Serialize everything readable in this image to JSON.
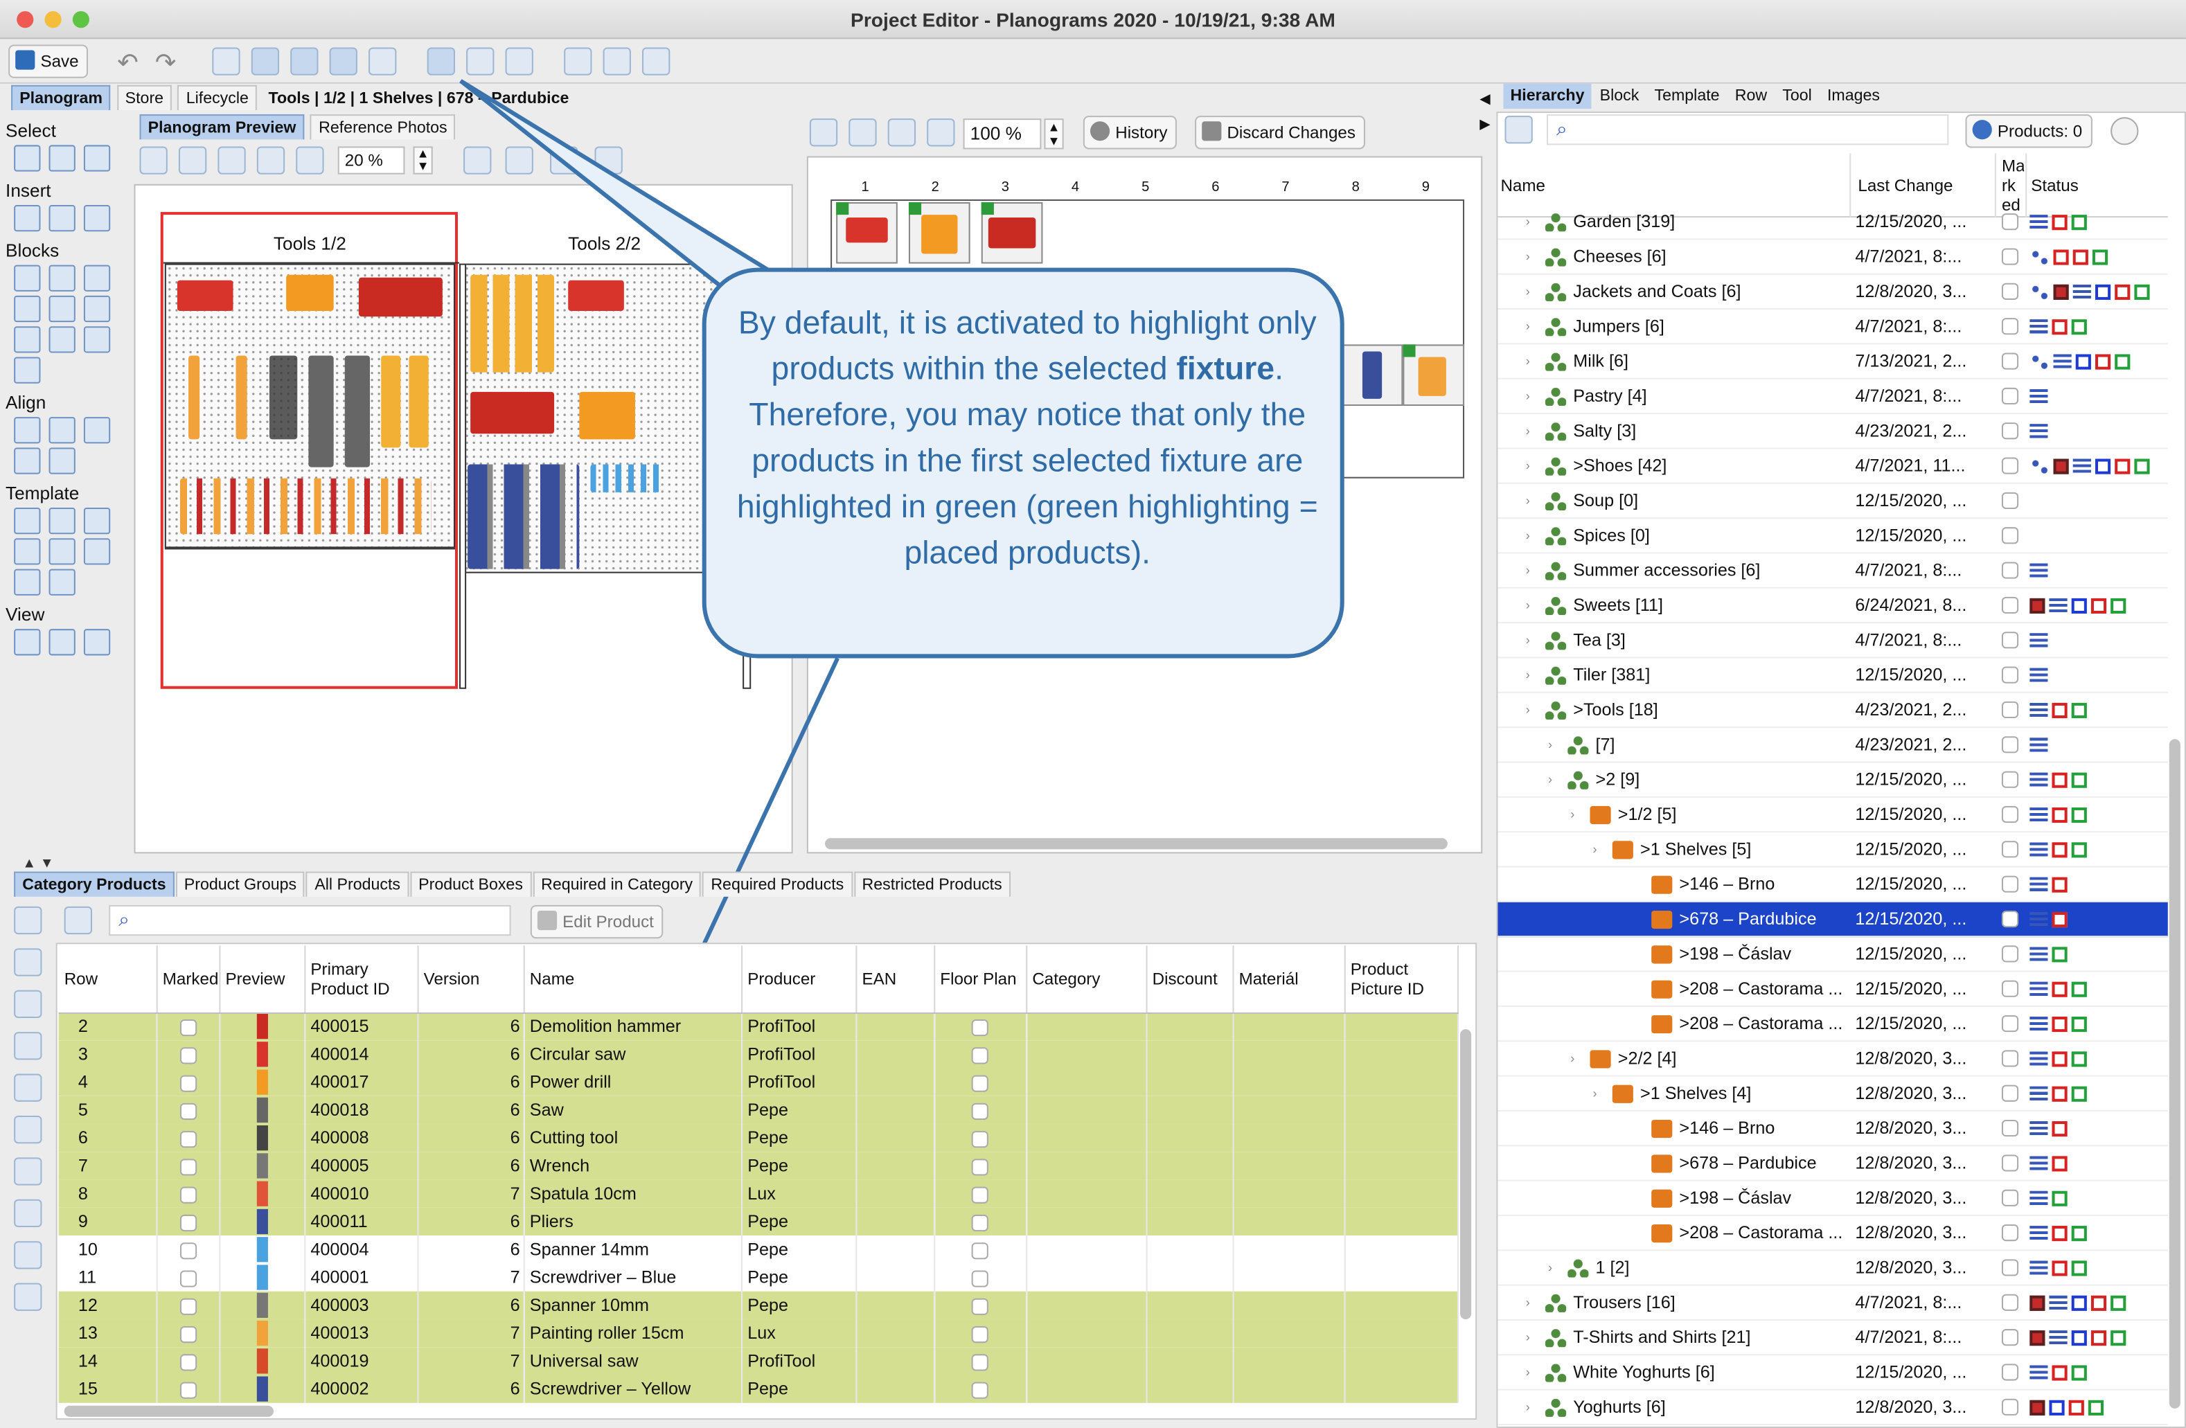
{
  "window": {
    "title": "Project Editor - Planograms 2020 - 10/19/21, 9:38 AM"
  },
  "toolbar": {
    "save_label": "Save"
  },
  "nav": {
    "tabs": [
      "Planogram",
      "Store",
      "Lifecycle"
    ],
    "breadcrumb": "Tools | 1/2 | 1 Shelves | 678 – Pardubice"
  },
  "left_palette": {
    "sections": [
      "Select",
      "Insert",
      "Blocks",
      "Align",
      "Template",
      "View"
    ]
  },
  "preview": {
    "tabs": [
      "Planogram Preview",
      "Reference Photos"
    ],
    "zoom": "20 %",
    "fixtures": [
      "Tools 1/2",
      "Tools 2/2"
    ]
  },
  "editor": {
    "zoom": "100 %",
    "history_label": "History",
    "discard_label": "Discard Changes",
    "columns": [
      "1",
      "2",
      "3",
      "4",
      "5",
      "6",
      "7",
      "8",
      "9"
    ]
  },
  "callout": {
    "text_before": "By default, it is activated to highlight only products within the selected ",
    "text_bold": "fixture",
    "text_after": ". Therefore, you may notice that only the products in the first selected fixture are highlighted in green (green highlighting = placed products)."
  },
  "product_tabs": [
    "Category Products",
    "Product Groups",
    "All Products",
    "Product Boxes",
    "Required in Category",
    "Required Products",
    "Restricted Products"
  ],
  "product_toolbar": {
    "edit_label": "Edit Product"
  },
  "product_table": {
    "headers": [
      "Row",
      "Marked",
      "Preview",
      "Primary Product ID",
      "Version",
      "Name",
      "Producer",
      "EAN",
      "Floor Plan",
      "Category",
      "Discount",
      "Materiál",
      "Product Picture ID"
    ],
    "rows": [
      {
        "row": "2",
        "id": "400015",
        "version": "6",
        "name": "Demolition hammer",
        "producer": "ProfiTool",
        "highlighted": true
      },
      {
        "row": "3",
        "id": "400014",
        "version": "6",
        "name": "Circular saw",
        "producer": "ProfiTool",
        "highlighted": true
      },
      {
        "row": "4",
        "id": "400017",
        "version": "6",
        "name": "Power drill",
        "producer": "ProfiTool",
        "highlighted": true
      },
      {
        "row": "5",
        "id": "400018",
        "version": "6",
        "name": "Saw",
        "producer": "Pepe",
        "highlighted": true
      },
      {
        "row": "6",
        "id": "400008",
        "version": "6",
        "name": "Cutting tool",
        "producer": "Pepe",
        "highlighted": true
      },
      {
        "row": "7",
        "id": "400005",
        "version": "6",
        "name": "Wrench",
        "producer": "Pepe",
        "highlighted": true
      },
      {
        "row": "8",
        "id": "400010",
        "version": "7",
        "name": "Spatula 10cm",
        "producer": "Lux",
        "highlighted": true
      },
      {
        "row": "9",
        "id": "400011",
        "version": "6",
        "name": "Pliers",
        "producer": "Pepe",
        "highlighted": true
      },
      {
        "row": "10",
        "id": "400004",
        "version": "6",
        "name": "Spanner 14mm",
        "producer": "Pepe",
        "highlighted": false
      },
      {
        "row": "11",
        "id": "400001",
        "version": "7",
        "name": "Screwdriver – Blue",
        "producer": "Pepe",
        "highlighted": false
      },
      {
        "row": "12",
        "id": "400003",
        "version": "6",
        "name": "Spanner 10mm",
        "producer": "Pepe",
        "highlighted": true
      },
      {
        "row": "13",
        "id": "400013",
        "version": "7",
        "name": "Painting roller 15cm",
        "producer": "Lux",
        "highlighted": true
      },
      {
        "row": "14",
        "id": "400019",
        "version": "7",
        "name": "Universal saw",
        "producer": "ProfiTool",
        "highlighted": true
      },
      {
        "row": "15",
        "id": "400002",
        "version": "6",
        "name": "Screwdriver – Yellow",
        "producer": "Pepe",
        "highlighted": true
      }
    ]
  },
  "hierarchy": {
    "tabs": [
      "Hierarchy",
      "Block",
      "Template",
      "Row",
      "Tool",
      "Images"
    ],
    "products_label": "Products: 0",
    "headers": [
      "Name",
      "Last Change",
      "Ma rk ed",
      "Status"
    ],
    "rows": [
      {
        "name": "Garden [319]",
        "date": "12/15/2020, ...",
        "indent": 0,
        "status": [
          "l",
          "r",
          "g"
        ]
      },
      {
        "name": "Cheeses [6]",
        "date": "4/7/2021, 8:...",
        "indent": 0,
        "status": [
          "h",
          "r",
          "r",
          "g"
        ]
      },
      {
        "name": "Jackets and Coats [6]",
        "date": "12/8/2020, 3...",
        "indent": 0,
        "status": [
          "h",
          "x",
          "l",
          "b",
          "r",
          "g"
        ]
      },
      {
        "name": "Jumpers [6]",
        "date": "4/7/2021, 8:...",
        "indent": 0,
        "status": [
          "l",
          "r",
          "g"
        ]
      },
      {
        "name": "Milk [6]",
        "date": "7/13/2021, 2...",
        "indent": 0,
        "status": [
          "h",
          "l",
          "b",
          "r",
          "g"
        ]
      },
      {
        "name": "Pastry [4]",
        "date": "4/7/2021, 8:...",
        "indent": 0,
        "status": [
          "l"
        ]
      },
      {
        "name": "Salty [3]",
        "date": "4/23/2021, 2...",
        "indent": 0,
        "status": [
          "l"
        ]
      },
      {
        "name": ">Shoes [42]",
        "date": "4/7/2021, 11...",
        "indent": 0,
        "status": [
          "h",
          "x",
          "l",
          "b",
          "r",
          "g"
        ]
      },
      {
        "name": "Soup [0]",
        "date": "12/15/2020, ...",
        "indent": 0,
        "status": []
      },
      {
        "name": "Spices [0]",
        "date": "12/15/2020, ...",
        "indent": 0,
        "status": []
      },
      {
        "name": "Summer accessories [6]",
        "date": "4/7/2021, 8:...",
        "indent": 0,
        "status": [
          "l"
        ]
      },
      {
        "name": "Sweets [11]",
        "date": "6/24/2021, 8...",
        "indent": 0,
        "status": [
          "x",
          "l",
          "b",
          "r",
          "g"
        ]
      },
      {
        "name": "Tea [3]",
        "date": "4/7/2021, 8:...",
        "indent": 0,
        "status": [
          "l"
        ]
      },
      {
        "name": "Tiler [381]",
        "date": "12/15/2020, ...",
        "indent": 0,
        "status": [
          "l"
        ]
      },
      {
        "name": ">Tools [18]",
        "date": "4/23/2021, 2...",
        "indent": 0,
        "status": [
          "l",
          "r",
          "g"
        ]
      },
      {
        "name": "[7]",
        "date": "4/23/2021, 2...",
        "indent": 1,
        "status": [
          "l"
        ]
      },
      {
        "name": ">2 [9]",
        "date": "12/15/2020, ...",
        "indent": 1,
        "status": [
          "l",
          "r",
          "g"
        ]
      },
      {
        "name": ">1/2 [5]",
        "date": "12/15/2020, ...",
        "indent": 2,
        "status": [
          "l",
          "r",
          "g"
        ]
      },
      {
        "name": ">1 Shelves [5]",
        "date": "12/15/2020, ...",
        "indent": 3,
        "status": [
          "l",
          "r",
          "g"
        ]
      },
      {
        "name": ">146 – Brno",
        "date": "12/15/2020, ...",
        "indent": 4,
        "status": [
          "l",
          "r"
        ]
      },
      {
        "name": ">678 – Pardubice",
        "date": "12/15/2020, ...",
        "indent": 4,
        "status": [
          "l",
          "r"
        ],
        "selected": true
      },
      {
        "name": ">198 – Čáslav",
        "date": "12/15/2020, ...",
        "indent": 4,
        "status": [
          "l",
          "g"
        ]
      },
      {
        "name": ">208 – Castorama ...",
        "date": "12/15/2020, ...",
        "indent": 4,
        "status": [
          "l",
          "r",
          "g"
        ]
      },
      {
        "name": ">208 – Castorama ...",
        "date": "12/15/2020, ...",
        "indent": 4,
        "status": [
          "l",
          "r",
          "g"
        ]
      },
      {
        "name": ">2/2 [4]",
        "date": "12/8/2020, 3...",
        "indent": 2,
        "status": [
          "l",
          "r",
          "g"
        ]
      },
      {
        "name": ">1 Shelves [4]",
        "date": "12/8/2020, 3...",
        "indent": 3,
        "status": [
          "l",
          "r",
          "g"
        ]
      },
      {
        "name": ">146 – Brno",
        "date": "12/8/2020, 3...",
        "indent": 4,
        "status": [
          "l",
          "r"
        ]
      },
      {
        "name": ">678 – Pardubice",
        "date": "12/8/2020, 3...",
        "indent": 4,
        "status": [
          "l",
          "r"
        ]
      },
      {
        "name": ">198 – Čáslav",
        "date": "12/8/2020, 3...",
        "indent": 4,
        "status": [
          "l",
          "g"
        ]
      },
      {
        "name": ">208 – Castorama ...",
        "date": "12/8/2020, 3...",
        "indent": 4,
        "status": [
          "l",
          "r",
          "g"
        ]
      },
      {
        "name": "1 [2]",
        "date": "12/8/2020, 3...",
        "indent": 1,
        "status": [
          "l",
          "r",
          "g"
        ]
      },
      {
        "name": "Trousers [16]",
        "date": "4/7/2021, 8:...",
        "indent": 0,
        "status": [
          "x",
          "l",
          "b",
          "r",
          "g"
        ]
      },
      {
        "name": "T-Shirts and Shirts [21]",
        "date": "4/7/2021, 8:...",
        "indent": 0,
        "status": [
          "x",
          "l",
          "b",
          "r",
          "g"
        ]
      },
      {
        "name": "White Yoghurts [6]",
        "date": "12/15/2020, ...",
        "indent": 0,
        "status": [
          "l",
          "r",
          "g"
        ]
      },
      {
        "name": "Yoghurts [6]",
        "date": "12/8/2020, 3...",
        "indent": 0,
        "status": [
          "x",
          "b",
          "r",
          "g"
        ]
      }
    ]
  },
  "colors": {
    "highlight_green": "#d4df92",
    "selection_blue": "#1c44c8",
    "callout_border": "#3b73ad",
    "callout_text": "#2f6ba7"
  }
}
